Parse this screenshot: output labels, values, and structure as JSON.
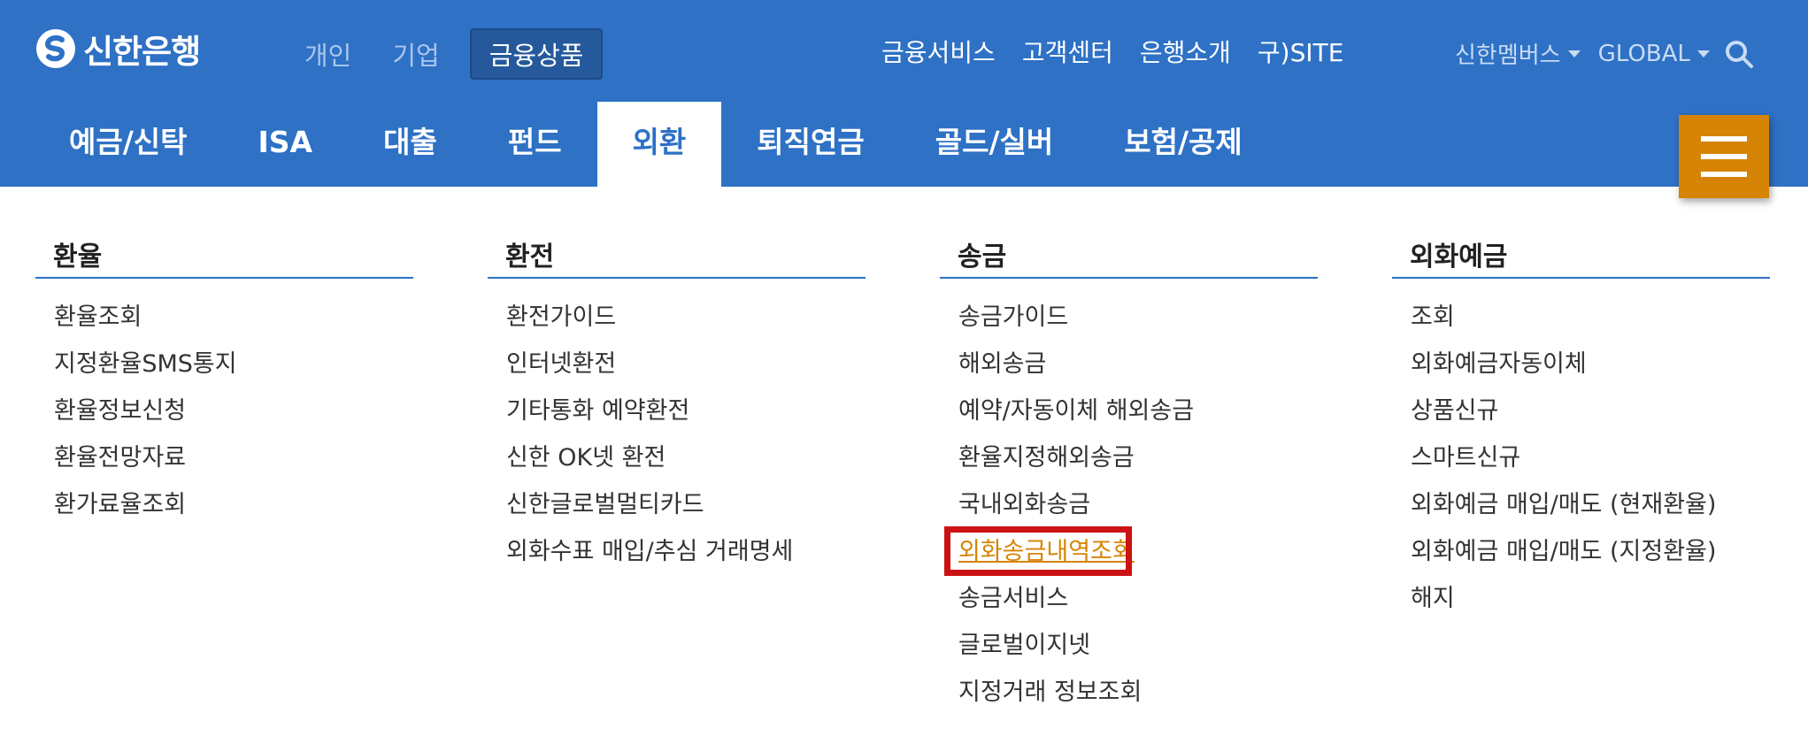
{
  "brand": {
    "name": "신한은행"
  },
  "segments": [
    {
      "label": "개인",
      "active": false
    },
    {
      "label": "기업",
      "active": false
    },
    {
      "label": "금융상품",
      "active": true
    }
  ],
  "utility_links": [
    "금융서비스",
    "고객센터",
    "은행소개",
    "구)SITE"
  ],
  "right_links": {
    "members": "신한멤버스",
    "global": "GLOBAL"
  },
  "main_nav": [
    {
      "label": "예금/신탁",
      "active": false
    },
    {
      "label": "ISA",
      "active": false
    },
    {
      "label": "대출",
      "active": false
    },
    {
      "label": "펀드",
      "active": false
    },
    {
      "label": "외환",
      "active": true
    },
    {
      "label": "퇴직연금",
      "active": false
    },
    {
      "label": "골드/실버",
      "active": false
    },
    {
      "label": "보험/공제",
      "active": false
    }
  ],
  "columns": [
    {
      "title": "환율",
      "items": [
        "환율조회",
        "지정환율SMS통지",
        "환율정보신청",
        "환율전망자료",
        "환가료율조회"
      ]
    },
    {
      "title": "환전",
      "items": [
        "환전가이드",
        "인터넷환전",
        "기타통화 예약환전",
        "신한 OK넷 환전",
        "신한글로벌멀티카드",
        "외화수표 매입/추심 거래명세"
      ]
    },
    {
      "title": "송금",
      "items": [
        "송금가이드",
        "해외송금",
        "예약/자동이체 해외송금",
        "환율지정해외송금",
        "국내외화송금",
        "외화송금내역조회",
        "송금서비스",
        "글로벌이지넷",
        "지정거래 정보조회"
      ],
      "highlighted_index": 5
    },
    {
      "title": "외화예금",
      "items": [
        "조회",
        "외화예금자동이체",
        "상품신규",
        "스마트신규",
        "외화예금 매입/매도 (현재환율)",
        "외화예금 매입/매도 (지정환율)",
        "해지"
      ]
    }
  ],
  "colors": {
    "primary_blue": "#2e71c5",
    "accent_orange": "#d68406",
    "highlight_red": "#cc1212"
  },
  "icons": [
    "shinhan-logo-icon",
    "chevron-down-icon",
    "search-icon",
    "hamburger-menu-icon"
  ]
}
